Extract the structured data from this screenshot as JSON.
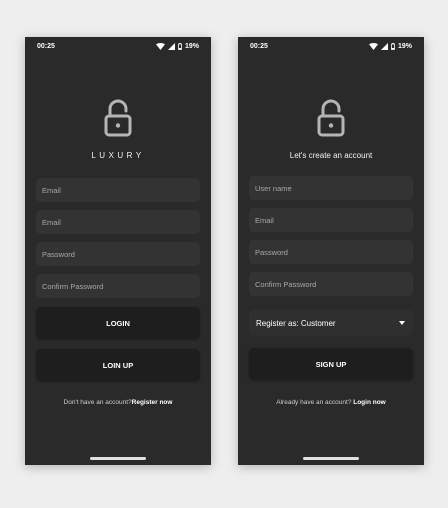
{
  "status_bar": {
    "time": "00:25",
    "battery": "19%"
  },
  "login": {
    "brand": "LUXURY",
    "fields": [
      {
        "placeholder": "Email"
      },
      {
        "placeholder": "Email"
      },
      {
        "placeholder": "Password"
      },
      {
        "placeholder": "Confirm Password"
      }
    ],
    "login_button": "LOGIN",
    "secondary_button": "LOIN UP",
    "footer_text": "Don't have an account?",
    "footer_link": "Register now"
  },
  "signup": {
    "subtitle": "Let's create an account",
    "fields": [
      {
        "placeholder": "User name"
      },
      {
        "placeholder": "Email"
      },
      {
        "placeholder": "Password"
      },
      {
        "placeholder": "Confirm Password"
      }
    ],
    "register_as": "Register as: Customer",
    "signup_button": "SIGN UP",
    "footer_text": "Already have an account? ",
    "footer_link": "Login now"
  },
  "icons": {
    "lock": "unlocked-padlock-icon",
    "wifi": "wifi-icon",
    "signal": "cell-signal-icon",
    "battery": "battery-icon",
    "dropdown": "chevron-down-icon"
  },
  "colors": {
    "page_background": "#eeeeee",
    "screen_background": "#2a2a2a",
    "field_background": "#333333",
    "button_background": "#1e1e1e",
    "text": "#ffffff"
  }
}
